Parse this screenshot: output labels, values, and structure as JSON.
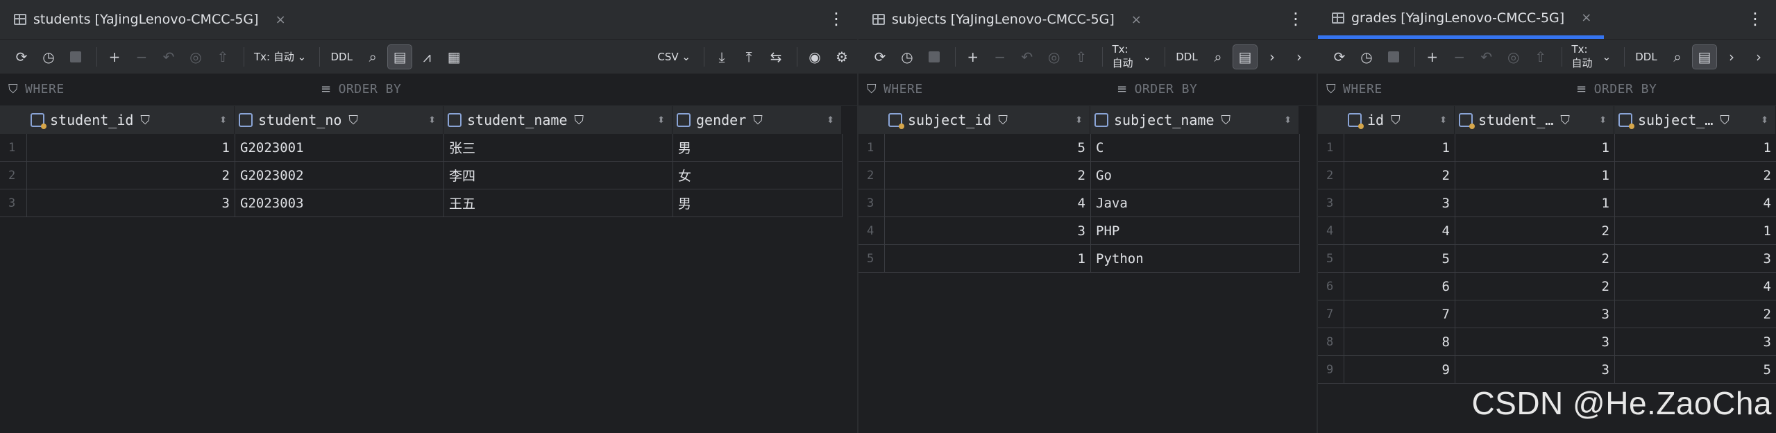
{
  "panels": [
    {
      "tab": {
        "title": "students [YaJingLenovo-CMCC-5G]",
        "close": "×",
        "more": "⋮"
      },
      "toolbar": {
        "tx": "Tx: 自动",
        "ddl": "DDL",
        "csv": "CSV"
      },
      "filter": {
        "where": "WHERE",
        "order_by": "ORDER BY"
      },
      "columns": [
        {
          "name": "student_id"
        },
        {
          "name": "student_no"
        },
        {
          "name": "student_name"
        },
        {
          "name": "gender"
        }
      ],
      "rows": [
        {
          "n": "1",
          "cells": [
            "1",
            "G2023001",
            "张三",
            "男"
          ]
        },
        {
          "n": "2",
          "cells": [
            "2",
            "G2023002",
            "李四",
            "女"
          ]
        },
        {
          "n": "3",
          "cells": [
            "3",
            "G2023003",
            "王五",
            "男"
          ]
        }
      ]
    },
    {
      "tab": {
        "title": "subjects [YaJingLenovo-CMCC-5G]",
        "close": "×",
        "more": "⋮"
      },
      "toolbar": {
        "tx": "Tx: 自动",
        "ddl": "DDL"
      },
      "filter": {
        "where": "WHERE",
        "order_by": "ORDER BY"
      },
      "columns": [
        {
          "name": "subject_id"
        },
        {
          "name": "subject_name"
        }
      ],
      "rows": [
        {
          "n": "1",
          "cells": [
            "5",
            "C"
          ]
        },
        {
          "n": "2",
          "cells": [
            "2",
            "Go"
          ]
        },
        {
          "n": "3",
          "cells": [
            "4",
            "Java"
          ]
        },
        {
          "n": "4",
          "cells": [
            "3",
            "PHP"
          ]
        },
        {
          "n": "5",
          "cells": [
            "1",
            "Python"
          ]
        }
      ]
    },
    {
      "tab": {
        "title": "grades [YaJingLenovo-CMCC-5G]",
        "close": "×",
        "more": "⋮"
      },
      "toolbar": {
        "tx": "Tx: 自动",
        "ddl": "DDL"
      },
      "filter": {
        "where": "WHERE",
        "order_by": "ORDER BY"
      },
      "columns": [
        {
          "name": "id"
        },
        {
          "name": "student_…"
        },
        {
          "name": "subject_…"
        }
      ],
      "rows": [
        {
          "n": "1",
          "cells": [
            "1",
            "1",
            "1"
          ]
        },
        {
          "n": "2",
          "cells": [
            "2",
            "1",
            "2"
          ]
        },
        {
          "n": "3",
          "cells": [
            "3",
            "1",
            "4"
          ]
        },
        {
          "n": "4",
          "cells": [
            "4",
            "2",
            "1"
          ]
        },
        {
          "n": "5",
          "cells": [
            "5",
            "2",
            "3"
          ]
        },
        {
          "n": "6",
          "cells": [
            "6",
            "2",
            "4"
          ]
        },
        {
          "n": "7",
          "cells": [
            "7",
            "3",
            "2"
          ]
        },
        {
          "n": "8",
          "cells": [
            "8",
            "3",
            "3"
          ]
        },
        {
          "n": "9",
          "cells": [
            "9",
            "3",
            "5"
          ]
        }
      ]
    }
  ],
  "watermark": "CSDN @He.ZaoCha",
  "colors": {
    "background": "#1e1f22",
    "panel": "#2b2d30",
    "accent": "#3574f0",
    "text": "#dfe1e5"
  }
}
